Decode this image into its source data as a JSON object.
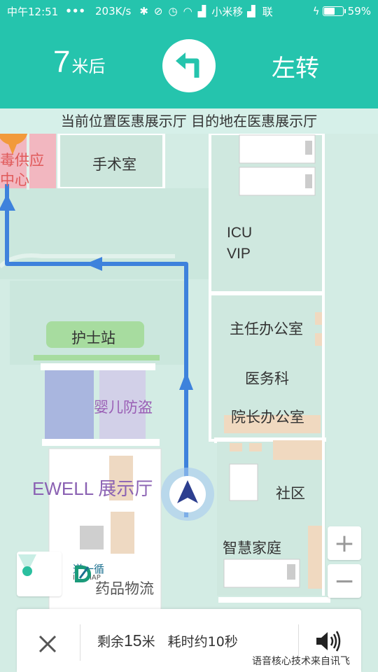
{
  "status_bar": {
    "time": "中午12:51",
    "dots": "•••",
    "speed": "203K/s",
    "carrier1": "小米移",
    "carrier2": "联",
    "battery": "59%"
  },
  "nav": {
    "distance_value": "7",
    "distance_unit": "米后",
    "turn_label": "左转",
    "turn_icon": "turn-left-arrow-icon"
  },
  "info": {
    "location_text": "当前位置医惠展示厅  目的地在医惠展示厅"
  },
  "map": {
    "labels": {
      "disinfect_1": "毒供应",
      "disinfect_2": "中心",
      "operating_room": "手术室",
      "icu": "ICU",
      "vip": "VIP",
      "director_office": "主任办公室",
      "medical_affairs": "医务科",
      "nurse_station": "护士站",
      "infant_security": "婴儿防盗",
      "president_office": "院长办公室",
      "ewell": "EWELL 展示厅",
      "community": "社区",
      "smart_home": "智慧家庭",
      "drug_logistics": "药品物流"
    },
    "logo": {
      "name": "道一循",
      "sub": "IPSIMAP"
    },
    "zoom_in": "+",
    "zoom_out": "−",
    "colors": {
      "route": "#3e82dc",
      "header": "#25c4ad",
      "poi": "#f29a3b"
    }
  },
  "bottom": {
    "remain_prefix": "剩余",
    "remain_value": "15",
    "remain_unit": "米",
    "eta": "耗时约10秒",
    "credit": "语音核心技术来自讯飞"
  }
}
